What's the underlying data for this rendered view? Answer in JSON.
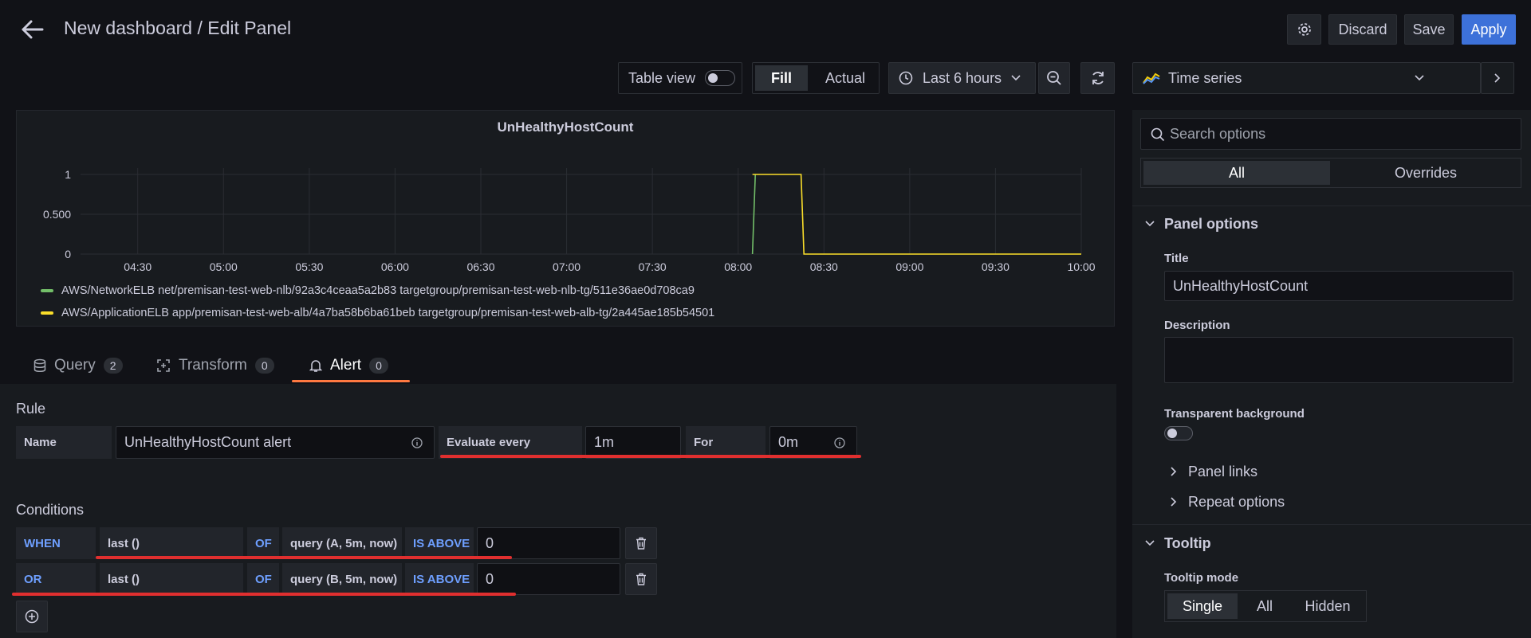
{
  "header": {
    "breadcrumb": "New dashboard / Edit Panel",
    "discard_label": "Discard",
    "save_label": "Save",
    "apply_label": "Apply"
  },
  "toolbar": {
    "table_view_label": "Table view",
    "fill_label": "Fill",
    "actual_label": "Actual",
    "time_range": "Last 6 hours",
    "visualization": "Time series"
  },
  "chart_data": {
    "type": "line",
    "title": "UnHealthyHostCount",
    "x_ticks": [
      "04:30",
      "05:00",
      "05:30",
      "06:00",
      "06:30",
      "07:00",
      "07:30",
      "08:00",
      "08:30",
      "09:00",
      "09:30",
      "10:00"
    ],
    "y_ticks": [
      "0",
      "0.500",
      "1"
    ],
    "ylim": [
      0,
      1
    ],
    "series": [
      {
        "name": "AWS/NetworkELB net/premisan-test-web-nlb/92a3c4ceaa5a2b83 targetgroup/premisan-test-web-nlb-tg/511e36ae0d708ca9",
        "color": "#73bf69",
        "points": [
          [
            "08:05",
            0
          ],
          [
            "08:06",
            1
          ]
        ]
      },
      {
        "name": "AWS/ApplicationELB app/premisan-test-web-alb/4a7ba58b6ba61beb targetgroup/premisan-test-web-alb-tg/2a445ae185b54501",
        "color": "#fade2a",
        "points": [
          [
            "08:05",
            1
          ],
          [
            "08:22",
            1
          ],
          [
            "08:23",
            0
          ],
          [
            "10:00",
            0
          ]
        ]
      }
    ]
  },
  "tabs": [
    {
      "label": "Query",
      "count": "2",
      "icon": "database-icon"
    },
    {
      "label": "Transform",
      "count": "0",
      "icon": "transform-icon"
    },
    {
      "label": "Alert",
      "count": "0",
      "icon": "bell-icon"
    }
  ],
  "alert": {
    "rule_heading": "Rule",
    "name_label": "Name",
    "name_value": "UnHealthyHostCount alert",
    "evaluate_label": "Evaluate every",
    "evaluate_value": "1m",
    "for_label": "For",
    "for_value": "0m",
    "conditions_heading": "Conditions",
    "conditions": [
      {
        "op": "WHEN",
        "func": "last ()",
        "of": "OF",
        "query": "query (A, 5m, now)",
        "cmp": "IS ABOVE",
        "value": "0"
      },
      {
        "op": "OR",
        "func": "last ()",
        "of": "OF",
        "query": "query (B, 5m, now)",
        "cmp": "IS ABOVE",
        "value": "0"
      }
    ]
  },
  "options": {
    "search_placeholder": "Search options",
    "all_tab": "All",
    "overrides_tab": "Overrides",
    "panel_options_heading": "Panel options",
    "title_label": "Title",
    "title_value": "UnHealthyHostCount",
    "description_label": "Description",
    "transparent_label": "Transparent background",
    "panel_links": "Panel links",
    "repeat_options": "Repeat options",
    "tooltip_heading": "Tooltip",
    "tooltip_mode_label": "Tooltip mode",
    "tooltip_modes": [
      "Single",
      "All",
      "Hidden"
    ]
  },
  "colors": {
    "accent": "#3d71d9",
    "alert_underline": "#ff7941",
    "annotation": "#e02f2f"
  }
}
